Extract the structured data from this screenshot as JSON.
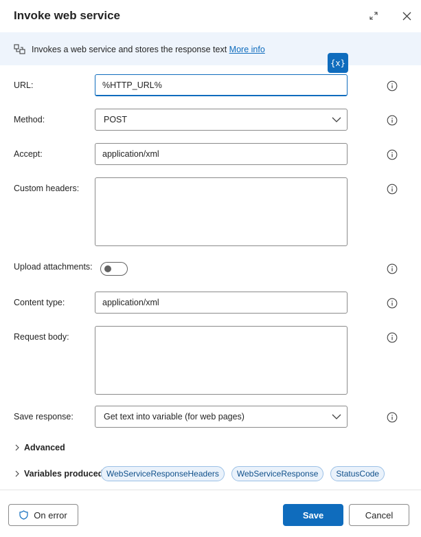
{
  "dialog": {
    "title": "Invoke web service"
  },
  "banner": {
    "text": "Invokes a web service and stores the response text",
    "link": "More info"
  },
  "variable_button": {
    "label": "{x}"
  },
  "fields": {
    "url": {
      "label": "URL:",
      "value": "%HTTP_URL%"
    },
    "method": {
      "label": "Method:",
      "value": "POST"
    },
    "accept": {
      "label": "Accept:",
      "value": "application/xml"
    },
    "custom_headers": {
      "label": "Custom headers:",
      "value": ""
    },
    "upload_attachments": {
      "label": "Upload attachments:",
      "enabled": false
    },
    "content_type": {
      "label": "Content type:",
      "value": "application/xml"
    },
    "request_body": {
      "label": "Request body:",
      "value": ""
    },
    "save_response": {
      "label": "Save response:",
      "value": "Get text into variable (for web pages)"
    }
  },
  "advanced": {
    "label": "Advanced"
  },
  "variables_produced": {
    "label": "Variables produced",
    "items": [
      "WebServiceResponseHeaders",
      "WebServiceResponse",
      "StatusCode"
    ]
  },
  "footer": {
    "on_error": "On error",
    "save": "Save",
    "cancel": "Cancel"
  },
  "colors": {
    "accent": "#0f6cbd",
    "banner_bg": "#eef4fc",
    "pill_bg": "#eaf2fb"
  }
}
